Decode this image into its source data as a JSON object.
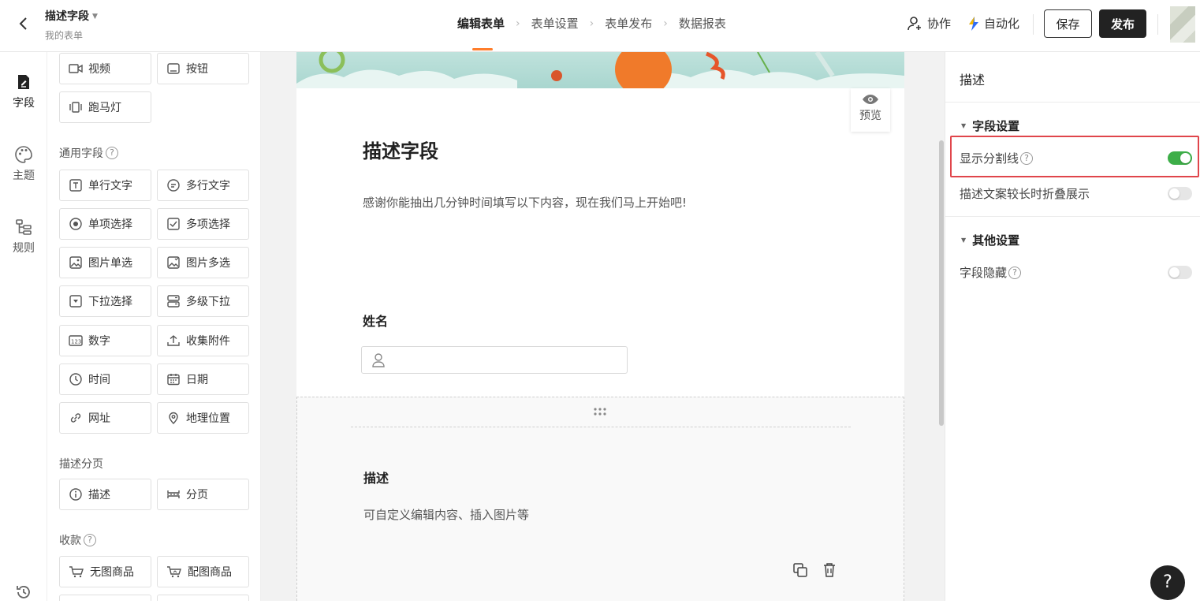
{
  "header": {
    "title": "描述字段",
    "subtitle": "我的表单",
    "steps": [
      "编辑表单",
      "表单设置",
      "表单发布",
      "数据报表"
    ],
    "collab_label": "协作",
    "automation_label": "自动化",
    "save_label": "保存",
    "publish_label": "发布"
  },
  "rail": {
    "items": [
      {
        "label": "字段",
        "icon": "field-icon"
      },
      {
        "label": "主题",
        "icon": "palette-icon"
      },
      {
        "label": "规则",
        "icon": "rules-icon"
      }
    ],
    "history_icon": "history-icon"
  },
  "fields": {
    "top": [
      "视频",
      "按钮",
      "跑马灯"
    ],
    "general_title": "通用字段",
    "general": [
      "单行文字",
      "多行文字",
      "单项选择",
      "多项选择",
      "图片单选",
      "图片多选",
      "下拉选择",
      "多级下拉",
      "数字",
      "收集附件",
      "时间",
      "日期",
      "网址",
      "地理位置"
    ],
    "desc_title": "描述分页",
    "desc": [
      "描述",
      "分页"
    ],
    "pay_title": "收款",
    "pay": [
      "无图商品",
      "配图商品"
    ]
  },
  "form": {
    "preview_label": "预览",
    "title": "描述字段",
    "description": "感谢你能抽出几分钟时间填写以下内容，现在我们马上开始吧!",
    "name_label": "姓名",
    "desc_block_label": "描述",
    "desc_block_text": "可自定义编辑内容、插入图片等"
  },
  "props": {
    "title": "描述",
    "group1": "字段设置",
    "show_divider": {
      "label": "显示分割线",
      "on": true
    },
    "fold_long": {
      "label": "描述文案较长时折叠展示",
      "on": false
    },
    "group2": "其他设置",
    "hide_field": {
      "label": "字段隐藏",
      "on": false
    }
  },
  "colors": {
    "accent": "#ff7d2b",
    "toggle_on": "#3dae48",
    "highlight": "#e0454b"
  }
}
